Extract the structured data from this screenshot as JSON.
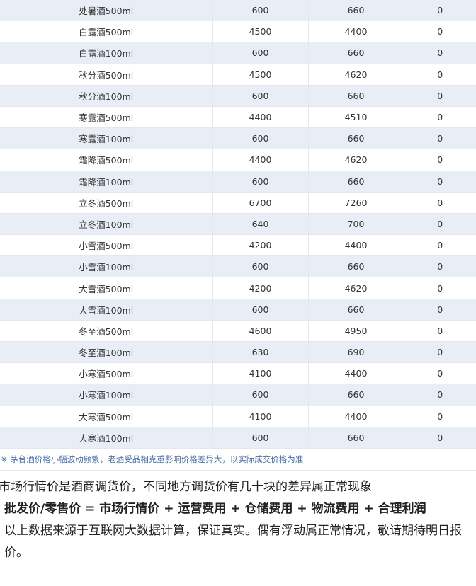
{
  "price_table": {
    "rows": [
      {
        "name": "处暑酒500ml",
        "col2": "600",
        "col3": "660",
        "col4": "0"
      },
      {
        "name": "白露酒500ml",
        "col2": "4500",
        "col3": "4400",
        "col4": "0"
      },
      {
        "name": "白露酒100ml",
        "col2": "600",
        "col3": "660",
        "col4": "0"
      },
      {
        "name": "秋分酒500ml",
        "col2": "4500",
        "col3": "4620",
        "col4": "0"
      },
      {
        "name": "秋分酒100ml",
        "col2": "600",
        "col3": "660",
        "col4": "0"
      },
      {
        "name": "寒露酒500ml",
        "col2": "4400",
        "col3": "4510",
        "col4": "0"
      },
      {
        "name": "寒露酒100ml",
        "col2": "600",
        "col3": "660",
        "col4": "0"
      },
      {
        "name": "霜降酒500ml",
        "col2": "4400",
        "col3": "4620",
        "col4": "0"
      },
      {
        "name": "霜降酒100ml",
        "col2": "600",
        "col3": "660",
        "col4": "0"
      },
      {
        "name": "立冬酒500ml",
        "col2": "6700",
        "col3": "7260",
        "col4": "0"
      },
      {
        "name": "立冬酒100ml",
        "col2": "640",
        "col3": "700",
        "col4": "0"
      },
      {
        "name": "小雪酒500ml",
        "col2": "4200",
        "col3": "4400",
        "col4": "0"
      },
      {
        "name": "小雪酒100ml",
        "col2": "600",
        "col3": "660",
        "col4": "0"
      },
      {
        "name": "大雪酒500ml",
        "col2": "4200",
        "col3": "4620",
        "col4": "0"
      },
      {
        "name": "大雪酒100ml",
        "col2": "600",
        "col3": "660",
        "col4": "0"
      },
      {
        "name": "冬至酒500ml",
        "col2": "4600",
        "col3": "4950",
        "col4": "0"
      },
      {
        "name": "冬至酒100ml",
        "col2": "630",
        "col3": "690",
        "col4": "0"
      },
      {
        "name": "小寒酒500ml",
        "col2": "4100",
        "col3": "4400",
        "col4": "0"
      },
      {
        "name": "小寒酒100ml",
        "col2": "600",
        "col3": "660",
        "col4": "0"
      },
      {
        "name": "大寒酒500ml",
        "col2": "4100",
        "col3": "4400",
        "col4": "0"
      },
      {
        "name": "大寒酒100ml",
        "col2": "600",
        "col3": "660",
        "col4": "0"
      }
    ]
  },
  "note": "※ 茅台酒价格小幅波动频繁，老酒受品相克重影响价格差异大，以实际成交价格为准",
  "description": {
    "line1": "市场行情价是酒商调货价，不同地方调货价有几十块的差异属正常现象",
    "line2": "批发价/零售价 = 市场行情价 + 运营费用 + 仓储费用 + 物流费用 + 合理利润",
    "line3": "以上数据来源于互联网大数据计算，保证真实。偶有浮动属正常情况，敬请期待明日报价。"
  }
}
